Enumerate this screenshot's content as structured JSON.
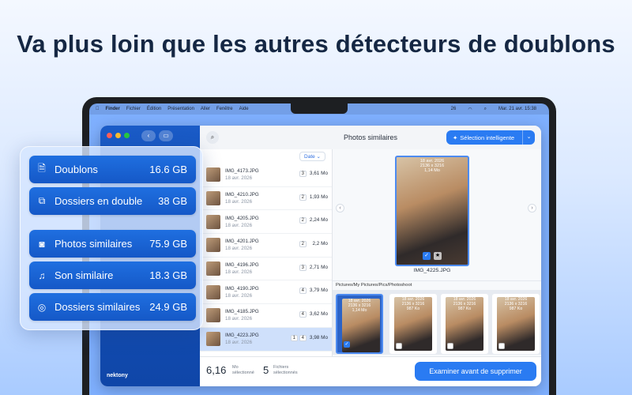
{
  "headline": "Va plus loin que les autres détecteurs de doublons",
  "menubar": {
    "items": [
      "Finder",
      "Fichier",
      "Édition",
      "Présentation",
      "Aller",
      "Fenêtre",
      "Aide"
    ],
    "battery": "26",
    "datetime": "Mar. 21 avr.  15:38"
  },
  "app": {
    "brand": "nektony",
    "title": "Photos similaires",
    "smart_selection": "Sélection intelligente",
    "sort_label": "Date ⌄",
    "files": [
      {
        "name": "IMG_4173.JPG",
        "date": "18 avr. 2026",
        "count": "3",
        "size": "3,61 Mo"
      },
      {
        "name": "IMG_4210.JPG",
        "date": "18 avr. 2026",
        "count": "2",
        "size": "1,93 Mo"
      },
      {
        "name": "IMG_4205.JPG",
        "date": "18 avr. 2026",
        "count": "2",
        "size": "2,24 Mo"
      },
      {
        "name": "IMG_4201.JPG",
        "date": "18 avr. 2026",
        "count": "2",
        "size": "2,2 Mo"
      },
      {
        "name": "IMG_4196.JPG",
        "date": "18 avr. 2026",
        "count": "3",
        "size": "2,71 Mo"
      },
      {
        "name": "IMG_4190.JPG",
        "date": "18 avr. 2026",
        "count": "4",
        "size": "3,79 Mo"
      },
      {
        "name": "IMG_4185.JPG",
        "date": "18 avr. 2026",
        "count": "4",
        "size": "3,62 Mo"
      },
      {
        "name": "IMG_4223.JPG",
        "date": "18 avr. 2026",
        "count_selected": "1",
        "count": "4",
        "size": "3,98 Mo"
      }
    ],
    "preview": {
      "meta_date": "18 avr. 2026",
      "meta_dims": "2136 x 3216",
      "meta_size": "1,14 Mo",
      "name": "IMG_4225.JPG",
      "path": "Pictures/My Pictures/Pics/Photoshoot"
    },
    "tiles": [
      {
        "date": "18 avr. 2026",
        "dims": "2136 x 3216",
        "size": "1,14 Mo",
        "check": "✓"
      },
      {
        "date": "18 avr. 2026",
        "dims": "2136 x 3216",
        "size": "987 Ko",
        "check": ""
      },
      {
        "date": "18 avr. 2026",
        "dims": "2136 x 3216",
        "size": "987 Ko",
        "check": ""
      },
      {
        "date": "18 avr. 2026",
        "dims": "2136 x 3216",
        "size": "987 Ko",
        "check": ""
      }
    ],
    "footer": {
      "size_value": "6,16",
      "size_unit": "Mo",
      "size_label": "sélectionné",
      "files_value": "5",
      "files_unit": "Fichiers",
      "files_label": "sélectionnés",
      "review_button": "Examiner avant de supprimer"
    }
  },
  "panel": {
    "items": [
      {
        "label": "Doublons",
        "value": "16.6 GB",
        "icon": "document-icon"
      },
      {
        "label": "Dossiers en double",
        "value": "38 GB",
        "icon": "copy-icon"
      },
      {
        "label": "Photos similaires",
        "value": "75.9 GB",
        "icon": "camera-icon"
      },
      {
        "label": "Son similaire",
        "value": "18.3 GB",
        "icon": "music-icon"
      },
      {
        "label": "Dossiers similaires",
        "value": "24.9 GB",
        "icon": "overlap-icon"
      }
    ]
  }
}
